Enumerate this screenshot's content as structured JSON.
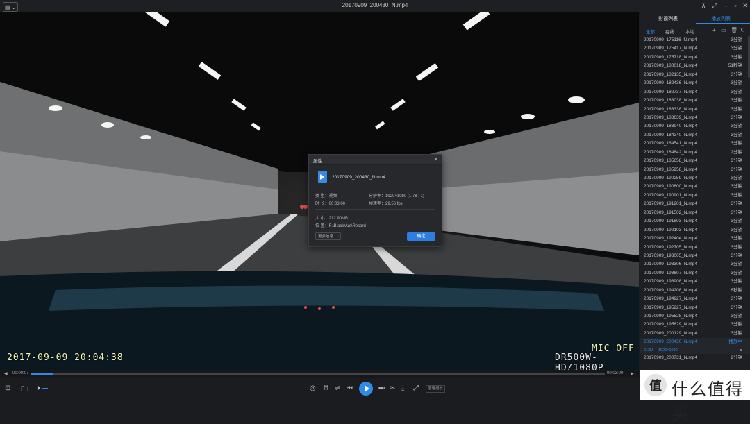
{
  "window": {
    "title": "20170909_200430_N.mp4"
  },
  "video": {
    "timestamp": "2017-09-09  20:04:38",
    "mic": "MIC OFF",
    "model": "DR500W-HD/1080P"
  },
  "dialog": {
    "title": "属性",
    "close": "✕",
    "filename": "20170909_200430_N.mp4",
    "type": "类 型：视频",
    "duration": "时 长：00:03:00",
    "resolution": "分辨率：1920×1080 (1.78 : 1)",
    "framerate": "帧速率：29.56 fps",
    "size": "大 小：212.90MB",
    "location": "位 置：F:\\BlackVue\\Record",
    "more": "更多信息",
    "ok": "确定"
  },
  "panel": {
    "tabs": [
      "影视列表",
      "播放列表"
    ],
    "filters": [
      "全部",
      "在线",
      "本地"
    ],
    "items": [
      {
        "name": "20170909_175116_N.mp4",
        "dur": "3分钟"
      },
      {
        "name": "20170909_175417_N.mp4",
        "dur": "3分钟"
      },
      {
        "name": "20170909_175718_N.mp4",
        "dur": "3分钟"
      },
      {
        "name": "20170909_180018_N.mp4",
        "dur": "51秒钟"
      },
      {
        "name": "20170909_182135_N.mp4",
        "dur": "3分钟"
      },
      {
        "name": "20170909_182436_N.mp4",
        "dur": "3分钟"
      },
      {
        "name": "20170909_182737_N.mp4",
        "dur": "3分钟"
      },
      {
        "name": "20170909_183038_N.mp4",
        "dur": "3分钟"
      },
      {
        "name": "20170909_183338_N.mp4",
        "dur": "3分钟"
      },
      {
        "name": "20170909_183639_N.mp4",
        "dur": "3分钟"
      },
      {
        "name": "20170909_183940_N.mp4",
        "dur": "3分钟"
      },
      {
        "name": "20170909_184240_N.mp4",
        "dur": "3分钟"
      },
      {
        "name": "20170909_184541_N.mp4",
        "dur": "3分钟"
      },
      {
        "name": "20170909_184842_N.mp4",
        "dur": "2分钟"
      },
      {
        "name": "20170909_185658_N.mp4",
        "dur": "3分钟"
      },
      {
        "name": "20170909_185958_N.mp4",
        "dur": "3分钟"
      },
      {
        "name": "20170909_190259_N.mp4",
        "dur": "3分钟"
      },
      {
        "name": "20170909_190600_N.mp4",
        "dur": "3分钟"
      },
      {
        "name": "20170909_190901_N.mp4",
        "dur": "3分钟"
      },
      {
        "name": "20170909_191201_N.mp4",
        "dur": "3分钟"
      },
      {
        "name": "20170909_191502_N.mp4",
        "dur": "3分钟"
      },
      {
        "name": "20170909_191803_N.mp4",
        "dur": "3分钟"
      },
      {
        "name": "20170909_192103_N.mp4",
        "dur": "3分钟"
      },
      {
        "name": "20170909_192404_N.mp4",
        "dur": "3分钟"
      },
      {
        "name": "20170909_192705_N.mp4",
        "dur": "3分钟"
      },
      {
        "name": "20170909_193005_N.mp4",
        "dur": "3分钟"
      },
      {
        "name": "20170909_193306_N.mp4",
        "dur": "3分钟"
      },
      {
        "name": "20170909_193607_N.mp4",
        "dur": "3分钟"
      },
      {
        "name": "20170909_193908_N.mp4",
        "dur": "3分钟"
      },
      {
        "name": "20170909_194208_N.mp4",
        "dur": "8秒钟"
      },
      {
        "name": "20170909_194927_N.mp4",
        "dur": "3分钟"
      },
      {
        "name": "20170909_195227_N.mp4",
        "dur": "3分钟"
      },
      {
        "name": "20170909_195528_N.mp4",
        "dur": "3分钟"
      },
      {
        "name": "20170909_195829_N.mp4",
        "dur": "3分钟"
      },
      {
        "name": "20170909_200129_N.mp4",
        "dur": "3分钟"
      }
    ],
    "playing": {
      "name": "20170909_200430_N.mp4",
      "status": "播放中",
      "size": "213M",
      "res": "1920×1080"
    },
    "after": {
      "name": "20170909_200731_N.mp4",
      "dur": "2分钟"
    }
  },
  "controls": {
    "current_time": "00:00:07",
    "total_time": "00:03:00",
    "progress": 0.04,
    "speed": "倍速播放"
  },
  "watermark": {
    "text": "什么值得买",
    "logo": "值"
  },
  "colors": {
    "accent": "#2f8ae8",
    "osd": "#f2f3b0"
  }
}
